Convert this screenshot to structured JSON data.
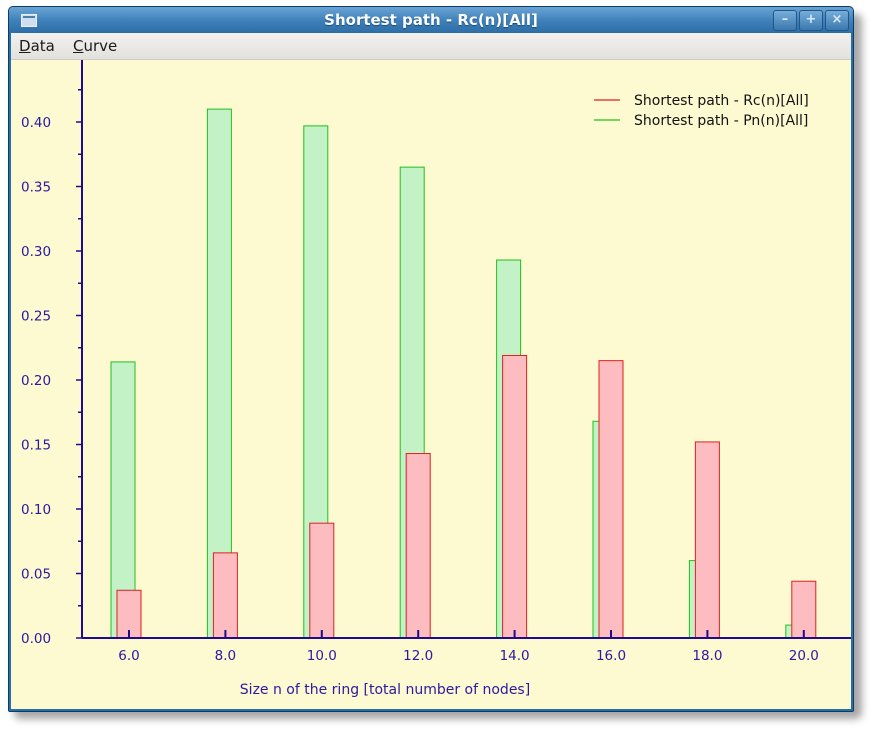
{
  "window": {
    "title": "Shortest path - Rc(n)[All]",
    "buttons": {
      "minimize": "–",
      "maximize": "+",
      "close": "×"
    }
  },
  "menubar": {
    "items": [
      {
        "underline": "D",
        "rest": "ata"
      },
      {
        "underline": "C",
        "rest": "urve"
      }
    ]
  },
  "colors": {
    "background": "#fdf9d1",
    "axis": "#1e0c8c",
    "tick_label": "#2a1aa0",
    "series_rc_fill": "#fdbcc0",
    "series_rc_stroke": "#e02020",
    "series_pn_fill": "#c2f2c6",
    "series_pn_stroke": "#20c020"
  },
  "chart_data": {
    "type": "bar",
    "title": "",
    "xlabel": "Size n of the ring [total number of nodes]",
    "ylabel": "",
    "x": [
      6,
      8,
      10,
      12,
      14,
      16,
      18,
      20
    ],
    "x_tick_labels": [
      "6.0",
      "8.0",
      "10.0",
      "12.0",
      "14.0",
      "16.0",
      "18.0",
      "20.0"
    ],
    "y_tick_labels": [
      "0.00",
      "0.05",
      "0.10",
      "0.15",
      "0.20",
      "0.25",
      "0.30",
      "0.35",
      "0.40"
    ],
    "xlim": [
      5,
      21
    ],
    "ylim": [
      0,
      0.44
    ],
    "grid": false,
    "legend_position": "top-right",
    "series": [
      {
        "name": "Shortest path - Rc(n)[All]",
        "values": [
          0.037,
          0.066,
          0.089,
          0.143,
          0.219,
          0.215,
          0.152,
          0.044
        ]
      },
      {
        "name": "Shortest path - Pn(n)[All]",
        "values": [
          0.214,
          0.41,
          0.397,
          0.365,
          0.293,
          0.168,
          0.06,
          0.01
        ]
      }
    ]
  }
}
